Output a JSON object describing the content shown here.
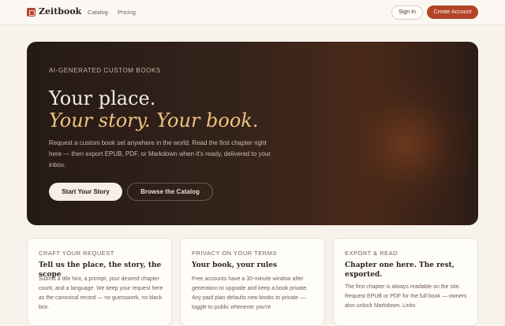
{
  "nav": {
    "brand": "Zeitbook",
    "links": [
      "Catalog",
      "Pricing"
    ],
    "signin": "Sign In",
    "create": "Create Account"
  },
  "hero": {
    "eyebrow": "AI-GENERATED CUSTOM BOOKS",
    "line1": "Your place.",
    "line2": "Your story. Your book.",
    "lead": "Request a custom book set anywhere in the world. Read the first chapter right here — then export EPUB, PDF, or Markdown when it's ready, delivered to your inbox.",
    "primary": "Start Your Story",
    "secondary": "Browse the Catalog"
  },
  "cards": [
    {
      "eyebrow": "CRAFT YOUR REQUEST",
      "title": "Tell us the place, the story, the scope",
      "body": "Submit a title hint, a prompt, your desired chapter count, and a language. We keep your request here as the canonical record — no guesswork, no black box."
    },
    {
      "eyebrow": "PRIVACY ON YOUR TERMS",
      "title": "Your book, your rules",
      "body": "Free accounts have a 30-minute window after generation to upgrade and keep a book private. Any paid plan defaults new books to private — toggle to public whenever you're"
    },
    {
      "eyebrow": "EXPORT & READ",
      "title": "Chapter one here. The rest, exported.",
      "body": "The first chapter is always readable on the site. Request EPUB or PDF for the full book — owners also unlock Markdown. Links"
    }
  ]
}
